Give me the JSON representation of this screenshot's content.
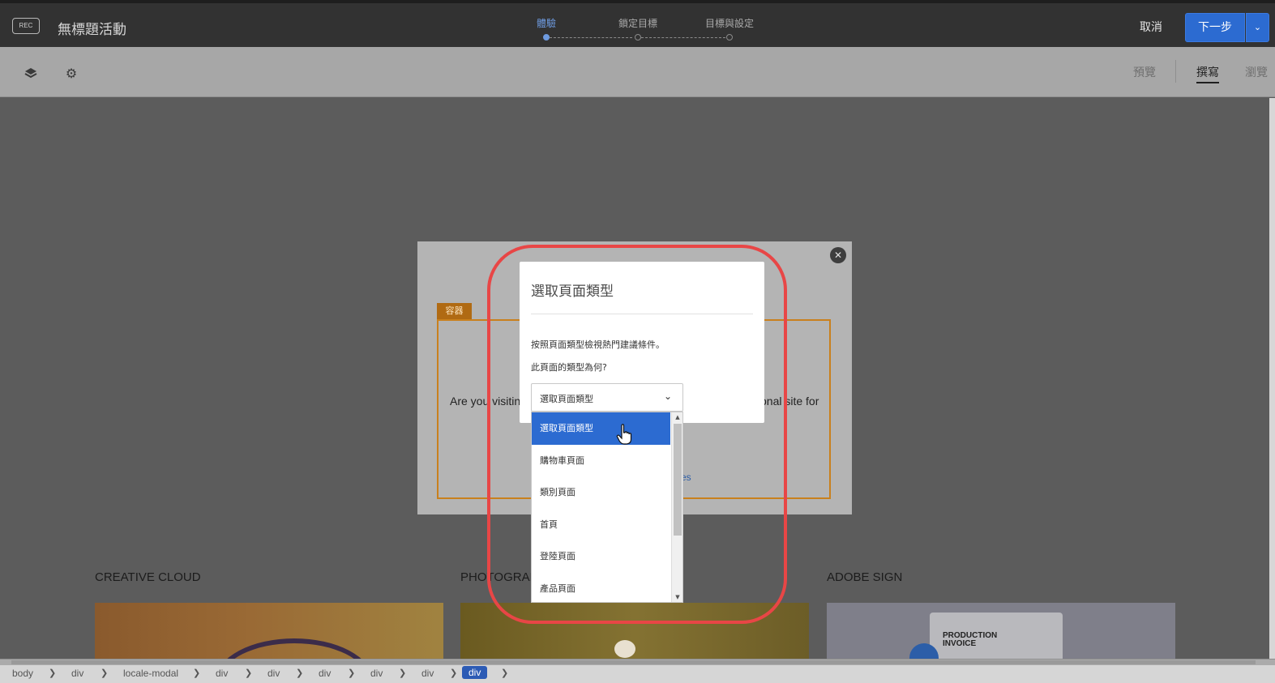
{
  "topbar": {
    "rec_label": "REC",
    "title": "無標題活動",
    "steps": [
      "體驗",
      "鎖定目標",
      "目標與設定"
    ],
    "cancel_label": "取消",
    "next_label": "下一步"
  },
  "toolbar": {
    "icons": [
      "layers-icon",
      "gear-icon"
    ],
    "modes": [
      "預覽",
      "撰寫",
      "瀏覽"
    ],
    "active_mode": "撰寫"
  },
  "page": {
    "container_tag": "容器",
    "visit_text_left": "Are you visitin",
    "visit_text_right": "onal site for",
    "link_fragment": "es",
    "sections": [
      {
        "title": "CREATIVE CLOUD"
      },
      {
        "title": "PHOTOGRAP"
      },
      {
        "title": "ADOBE SIGN"
      }
    ],
    "invoice_label": "PRODUCTION INVOICE"
  },
  "dialog": {
    "title": "選取頁面類型",
    "line1": "按照頁面類型檢視熱門建議條件。",
    "line2": "此頁面的類型為何?",
    "select_value": "選取頁面類型",
    "options": [
      "選取頁面類型",
      "購物車頁面",
      "類別頁面",
      "首頁",
      "登陸頁面",
      "產品頁面"
    ],
    "selected_index": 0
  },
  "breadcrumb": [
    "body",
    "div",
    "locale-modal",
    "div",
    "div",
    "div",
    "div",
    "div",
    "div"
  ],
  "colors": {
    "accent": "#2c6bd1",
    "container_orange": "#c9801d",
    "highlight_red": "#e84646"
  }
}
